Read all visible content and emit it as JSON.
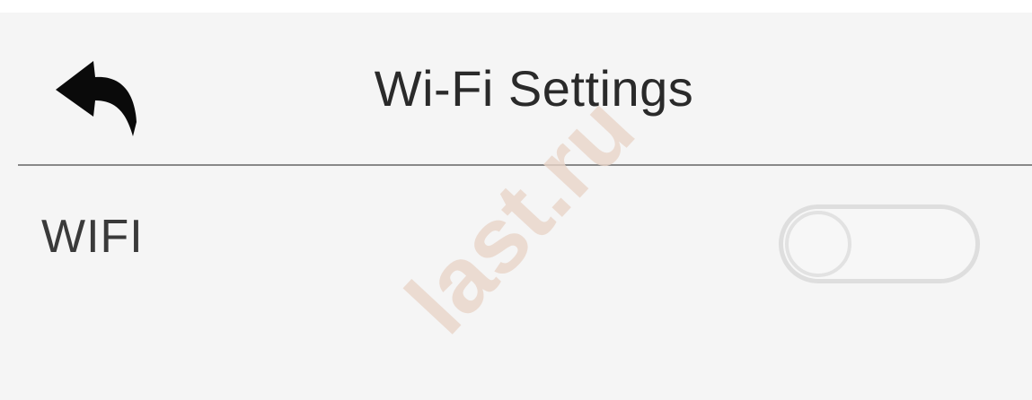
{
  "header": {
    "back_icon": "back-arrow-icon",
    "title": "Wi-Fi Settings"
  },
  "settings": {
    "wifi": {
      "label": "WIFI",
      "toggle_state": "off"
    }
  },
  "watermark": {
    "text": "last.ru"
  },
  "colors": {
    "background": "#f5f5f5",
    "divider": "#888888",
    "toggle_border": "#dedede",
    "watermark": "#e8d4c8"
  }
}
